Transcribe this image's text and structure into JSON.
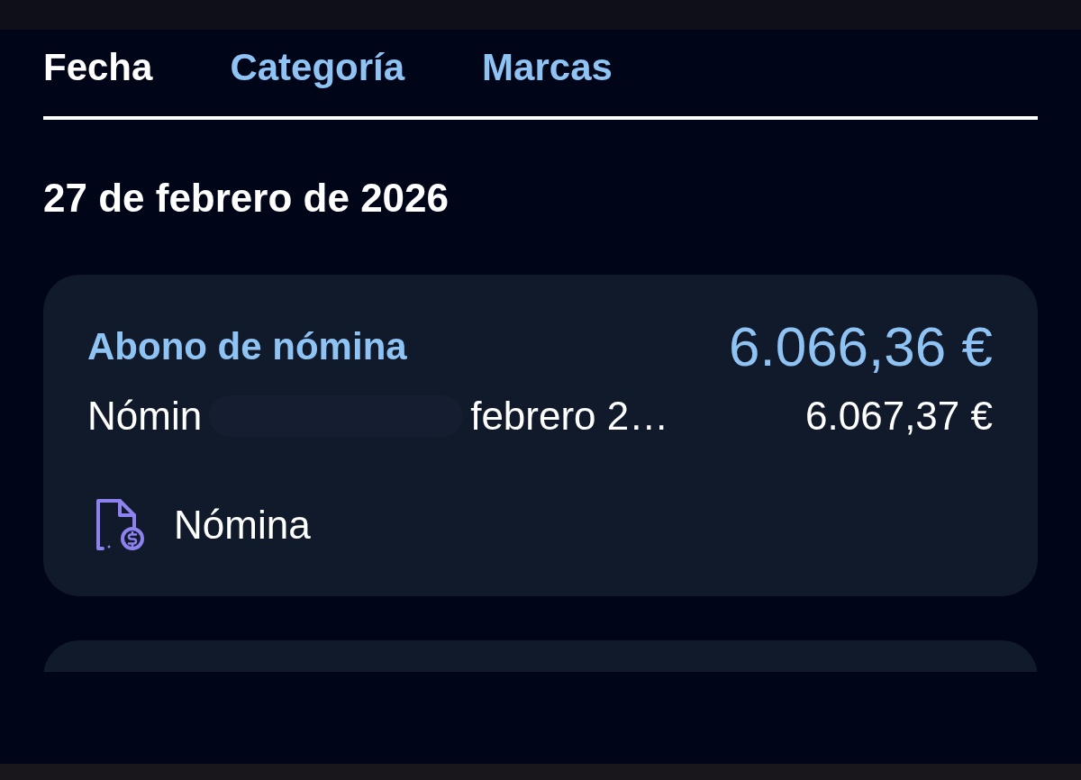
{
  "tabs": [
    {
      "label": "Fecha",
      "selected": true
    },
    {
      "label": "Categoría",
      "selected": false
    },
    {
      "label": "Marcas",
      "selected": false
    }
  ],
  "date_header": "27 de febrero de 2026",
  "transactions": [
    {
      "kind": "entry",
      "title": "Abono de nómina",
      "amount": "6.066,36 €",
      "description_start": "Nómin",
      "redacted": true,
      "description_end": "febrero 2…",
      "original_amount": "6.067,37 €",
      "category": "Nómina"
    },
    {
      "kind": "partial"
    }
  ]
}
